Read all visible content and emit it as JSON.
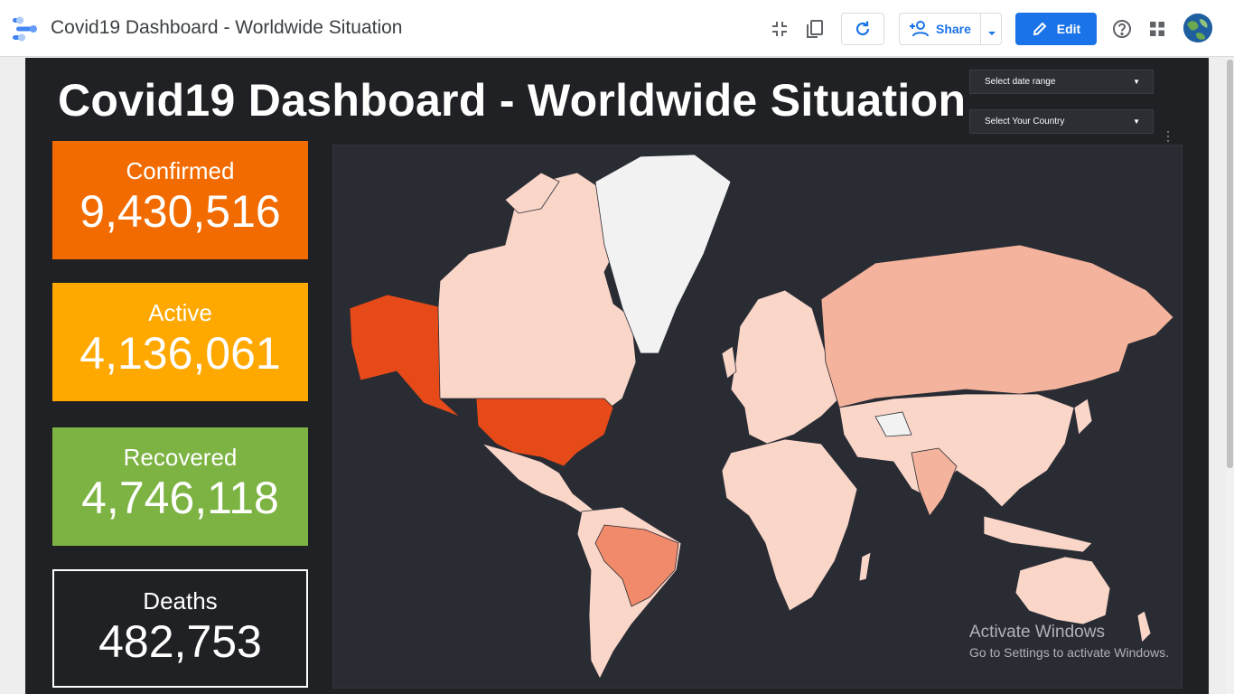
{
  "app": {
    "title": "Covid19 Dashboard - Worldwide Situation",
    "share_label": "Share",
    "edit_label": "Edit"
  },
  "report": {
    "title": "Covid19 Dashboard  - Worldwide Situation",
    "controls": {
      "date_range": "Select date range",
      "country": "Select Your Country"
    },
    "kpis": [
      {
        "label": "Confirmed",
        "value": "9,430,516",
        "color": "#f26b00"
      },
      {
        "label": "Active",
        "value": "4,136,061",
        "color": "#ffa800"
      },
      {
        "label": "Recovered",
        "value": "4,746,118",
        "color": "#7cb342"
      },
      {
        "label": "Deaths",
        "value": "482,753",
        "color": "#202124"
      }
    ],
    "map_colors": {
      "highest": "#e64a19",
      "high": "#f08a6a",
      "medium": "#f4b39c",
      "low": "#fad6c9",
      "none": "#f2f2f2",
      "water": "#2a2c34"
    }
  },
  "overlay": {
    "line1": "Activate Windows",
    "line2": "Go to Settings to activate Windows."
  }
}
